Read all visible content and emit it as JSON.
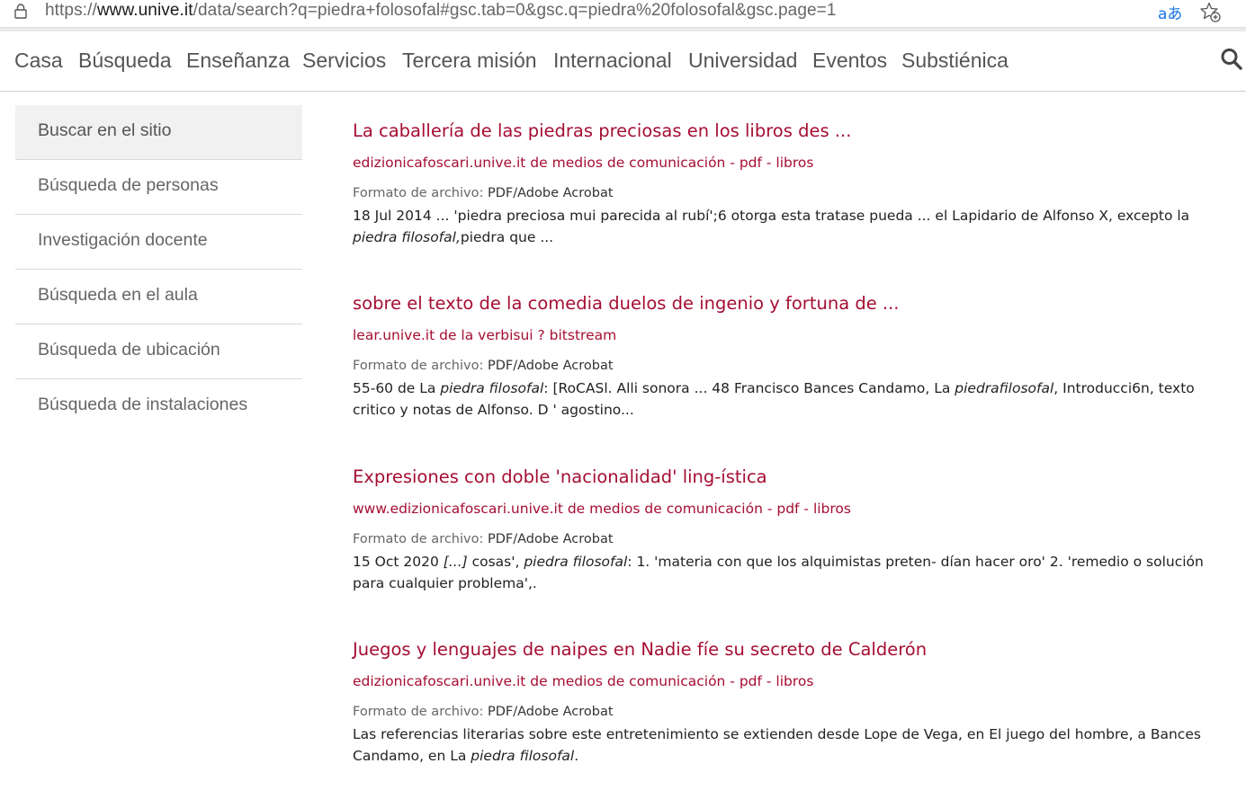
{
  "browser": {
    "url_prefix": "https://",
    "url_host": "www.unive.it",
    "url_path": "/data/search?q=piedra+folosofal#gsc.tab=0&gsc.q=piedra%20folosofal&gsc.page=1",
    "translate_glyph": "aあ"
  },
  "nav": {
    "items": [
      "Casa",
      "Búsqueda",
      "Enseñanza",
      "Servicios",
      "Tercera misión",
      "Internacional",
      "Universidad",
      "Eventos",
      "Substiénica"
    ]
  },
  "sidebar": {
    "items": [
      {
        "label": "Buscar en el sitio",
        "active": true
      },
      {
        "label": "Búsqueda de personas"
      },
      {
        "label": "Investigación docente"
      },
      {
        "label": "Búsqueda en el aula"
      },
      {
        "label": "Búsqueda de ubicación"
      },
      {
        "label": "Búsqueda de instalaciones"
      }
    ]
  },
  "results": [
    {
      "title": "La caballería de las piedras preciosas en los libros des ...",
      "url": "edizionicafoscari.unive.it de medios de comunicación - pdf - libros",
      "format_label": "Formato de archivo:",
      "format_value": "PDF/Adobe Acrobat",
      "snippet_parts": [
        {
          "t": "18 Jul 2014 ... 'piedra preciosa mui parecida al rubí';6 otorga esta tratase pueda ... el Lapidario de Alfonso X, excepto la "
        },
        {
          "t": "piedra filosofal,",
          "i": true
        },
        {
          "t": "piedra que ..."
        }
      ]
    },
    {
      "title": "sobre el texto de la comedia duelos de ingenio y fortuna de ...",
      "url": "lear.unive.it de la verbisui ? bitstream",
      "format_label": "Formato de archivo:",
      "format_value": "PDF/Adobe Acrobat",
      "snippet_parts": [
        {
          "t": "55-60 de La "
        },
        {
          "t": "piedra filosofal",
          "i": true
        },
        {
          "t": ": [RoCASl. Alli sonora ... 48 Francisco Bances Candamo, La "
        },
        {
          "t": "piedrafilosofal",
          "i": true
        },
        {
          "t": ", Introducci6n, texto critico y notas de Alfonso. D ' agostino..."
        }
      ]
    },
    {
      "title": "Expresiones con doble 'nacionalidad' ling-ística",
      "url": "www.edizionicafoscari.unive.it de medios de comunicación - pdf - libros",
      "format_label": "Formato de archivo:",
      "format_value": "PDF/Adobe Acrobat",
      "snippet_parts": [
        {
          "t": "15 Oct 2020 "
        },
        {
          "t": "[...]",
          "i": true
        },
        {
          "t": " cosas', "
        },
        {
          "t": "piedra filosofal",
          "i": true
        },
        {
          "t": ": 1. 'materia con que los alquimistas preten- dían hacer oro' 2. 'remedio o solución para cualquier problema',."
        }
      ]
    },
    {
      "title": "Juegos y lenguajes de naipes en Nadie fíe su secreto de Calderón",
      "url": "edizionicafoscari.unive.it de medios de comunicación - pdf - libros",
      "format_label": "Formato de archivo:",
      "format_value": "PDF/Adobe Acrobat",
      "snippet_parts": [
        {
          "t": "Las referencias literarias sobre este entretenimiento se extienden desde Lope de Vega, en El juego del hombre, a Bances Candamo, en La "
        },
        {
          "t": "piedra filosofal",
          "i": true
        },
        {
          "t": "."
        }
      ]
    }
  ]
}
